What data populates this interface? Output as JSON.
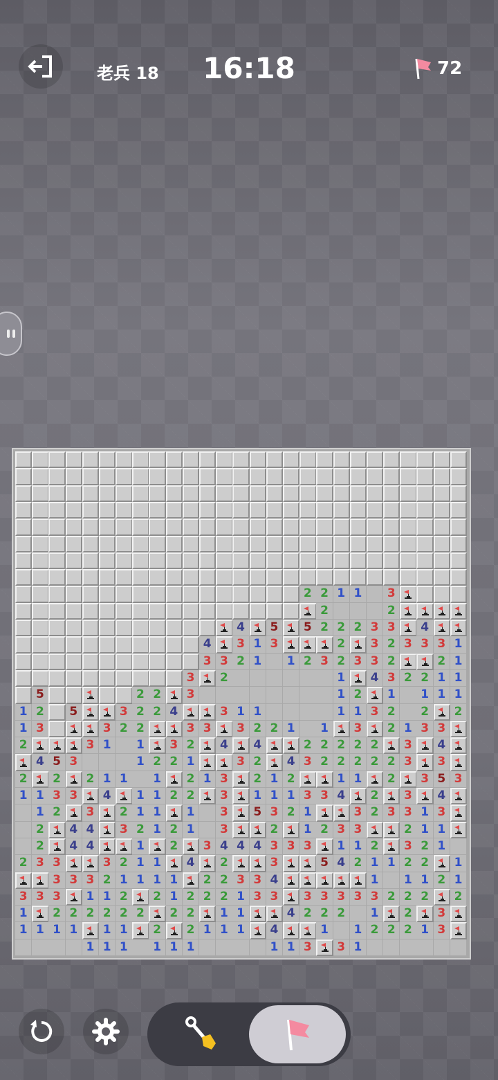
{
  "header": {
    "level_label": "老兵 18",
    "timer": "16:18",
    "flags_remaining": "72"
  },
  "icons": {
    "exit": "exit-icon",
    "flag": "flag-icon",
    "restart": "restart-icon",
    "settings": "gear-icon",
    "shovel": "shovel-icon"
  },
  "colors": {
    "1": "#3050c8",
    "2": "#3a9a3a",
    "3": "#d23a3a",
    "4": "#3a3f8c",
    "5": "#8a1c1c",
    "flag_red": "#e04848",
    "flag_pink": "#f48aa0"
  },
  "mode": {
    "selected": "flag"
  },
  "board": {
    "cols": 27,
    "rows": 30,
    "legend": {
      "#": "unopened",
      ".": "opened-empty",
      "F": "flagged",
      "1-8": "adjacent mine count"
    },
    "grid": [
      "###########################",
      "###########################",
      "###########################",
      "###########################",
      "###########################",
      "###########################",
      "###########################",
      "###########################",
      "#################2211.3F###",
      "#################F2...2FFFF",
      "############F4F5F522233F4FF",
      "###########4F313FFF2F323331",
      "###########3321.1232332FF21",
      "##########3F2......1F432211",
      "#5##F##22F3........12F1.111",
      "12#5FF3224FF311....1132.2F2",
      "13#FF322FF33F3221.1F3F2133F",
      "2FFF31.1F32F4F4FF22222F3F4F",
      "F453...1221FF32F43222223F3F",
      "2F2F211.1F213F212FF11F2F353",
      "1133F4F1122F3F111334F2F3F4F",
      ".12F3F211F1.3F5321FF323313F",
      ".2F44F32121.3FF2F1233FF211F",
      ".2F44FF1F2F3444333F112F321.",
      "233FF3211F4F2FF3FF5421122F1",
      "FF33321111F22334FFFFF1.1121",
      "333F112F21222133F33333222F2",
      "1F222222F22F11FF4222.1F2F3F",
      "1111F11F2F2111F4FF1.122213F",
      "....111.111....113F31......"
    ]
  }
}
